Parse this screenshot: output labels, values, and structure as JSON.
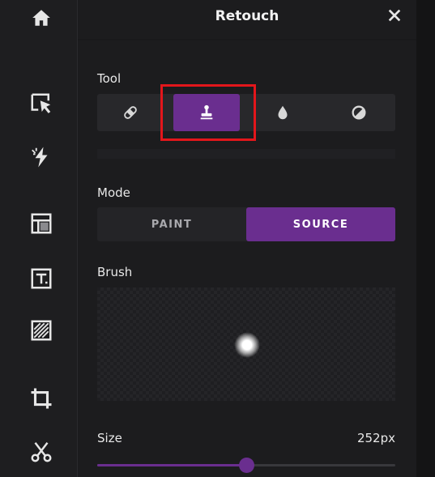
{
  "header": {
    "title": "Retouch",
    "close_icon": "close-icon"
  },
  "sidebar": {
    "items": [
      {
        "icon": "home-icon"
      },
      {
        "icon": "select-cursor-icon"
      },
      {
        "icon": "magic-bolt-icon"
      },
      {
        "icon": "layout-icon"
      },
      {
        "icon": "text-icon"
      },
      {
        "icon": "texture-icon"
      },
      {
        "icon": "crop-icon"
      },
      {
        "icon": "cutout-scissors-icon"
      }
    ]
  },
  "tool": {
    "label": "Tool",
    "options": [
      {
        "icon": "bandage-icon",
        "selected": false
      },
      {
        "icon": "clone-stamp-icon",
        "selected": true
      },
      {
        "icon": "droplet-icon",
        "selected": false
      },
      {
        "icon": "contrast-icon",
        "selected": false
      }
    ]
  },
  "mode": {
    "label": "Mode",
    "options": [
      {
        "label": "PAINT",
        "selected": false
      },
      {
        "label": "SOURCE",
        "selected": true
      }
    ]
  },
  "brush": {
    "label": "Brush"
  },
  "size": {
    "label": "Size",
    "value": "252px",
    "slider_fraction": 0.5
  },
  "colors": {
    "accent": "#6a2e8f",
    "highlight": "#e3161b",
    "background": "#1c1c1e"
  }
}
